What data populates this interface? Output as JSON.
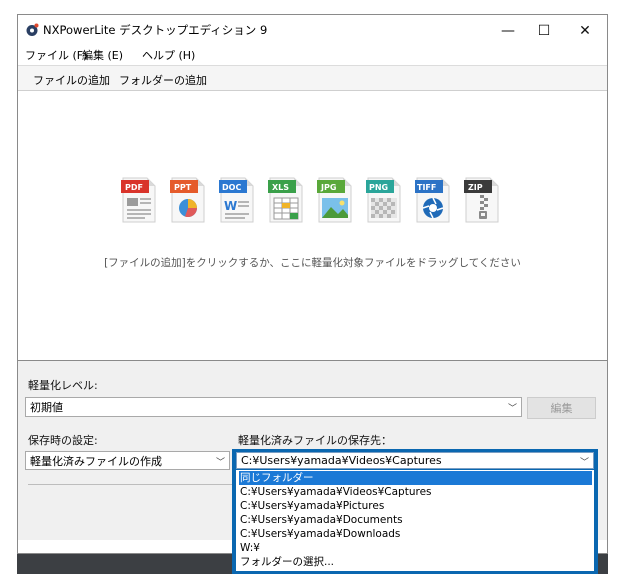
{
  "window": {
    "title": "NXPowerLite デスクトップエディション 9",
    "controls": {
      "minimize": "—",
      "maximize": "☐",
      "close": "✕"
    }
  },
  "menu": {
    "file": "ファイル (F)",
    "edit": "編集 (E)",
    "help": "ヘルプ (H)"
  },
  "toolbar": {
    "add_file": "ファイルの追加",
    "add_folder": "フォルダーの追加"
  },
  "file_types": [
    {
      "label": "PDF",
      "color": "#d9342b"
    },
    {
      "label": "PPT",
      "color": "#e55b2b"
    },
    {
      "label": "DOC",
      "color": "#2b78d1"
    },
    {
      "label": "XLS",
      "color": "#3aa04a"
    },
    {
      "label": "JPG",
      "color": "#5aa83a"
    },
    {
      "label": "PNG",
      "color": "#2aa59a"
    },
    {
      "label": "TIFF",
      "color": "#2c73c6"
    },
    {
      "label": "ZIP",
      "color": "#3a3a3a"
    }
  ],
  "drop_hint": "[ファイルの追加]をクリックするか、ここに軽量化対象ファイルをドラッグしてください",
  "settings": {
    "level_label": "軽量化レベル:",
    "level_value": "初期値",
    "edit_button": "編集",
    "save_label": "保存時の設定:",
    "save_value": "軽量化済みファイルの作成",
    "dest_label": "軽量化済みファイルの保存先：",
    "dest_value": "C:¥Users¥yamada¥Videos¥Captures"
  },
  "dest_options": [
    "同じフォルダー",
    "C:¥Users¥yamada¥Videos¥Captures",
    "C:¥Users¥yamada¥Pictures",
    "C:¥Users¥yamada¥Documents",
    "C:¥Users¥yamada¥Downloads",
    "W:¥",
    "フォルダーの選択..."
  ],
  "dest_selected_index": 0,
  "colors": {
    "accent": "#0a67b0",
    "selection": "#1b79d6",
    "desktop": "#3c3f43"
  }
}
